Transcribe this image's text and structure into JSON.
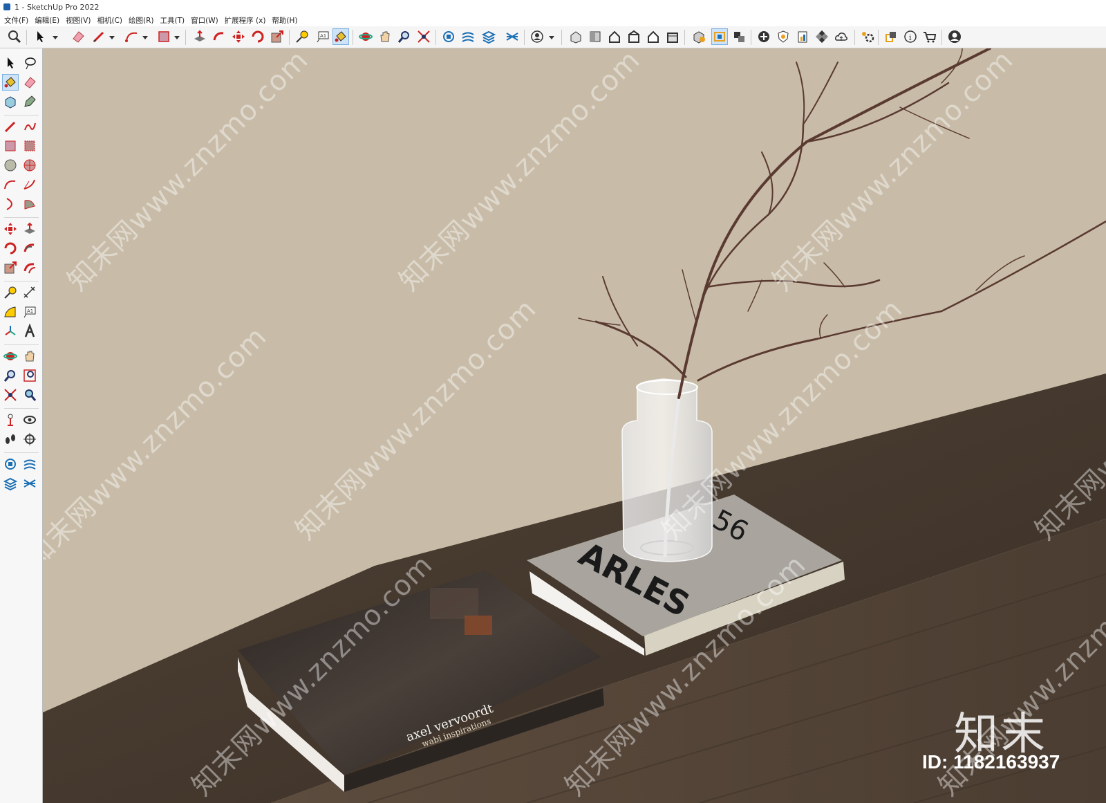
{
  "window": {
    "title": "1 - SketchUp Pro 2022"
  },
  "menu": [
    "文件(F)",
    "编辑(E)",
    "视图(V)",
    "相机(C)",
    "绘图(R)",
    "工具(T)",
    "窗口(W)",
    "扩展程序 (x)",
    "帮助(H)"
  ],
  "colors": {
    "wall": "#c8bca8",
    "counter": "#4a3c30",
    "accent": "#cfe3f7"
  },
  "toolbar_icons": [
    "search-icon",
    "select-icon",
    "eraser-icon",
    "pencil-icon",
    "arc-icon",
    "rectangle-icon",
    "pushpull-icon",
    "followme-icon",
    "move-icon",
    "rotate-icon",
    "scale-icon",
    "tapemeasure-icon",
    "text-icon",
    "paintbucket-icon",
    "orbit-icon",
    "pan-icon",
    "zoom-icon",
    "zoom-extents-icon",
    "warehouse-icon",
    "extension-warehouse-icon",
    "layers-icon",
    "sandbox-icon",
    "user-icon",
    "iso-view-icon",
    "top-view-icon",
    "front-view-icon",
    "right-view-icon",
    "back-view-icon",
    "left-view-icon",
    "xray-icon",
    "style-icon",
    "section-icon",
    "add-icon",
    "shield-icon",
    "report-icon",
    "checker-icon",
    "cloud-icon",
    "settings-icon",
    "components-icon",
    "info-icon",
    "cart-icon",
    "account-icon"
  ],
  "scene": {
    "book_dark": {
      "title": "axel vervoordt",
      "subtitle": "wabi inspirations"
    },
    "book_light": {
      "title": "ARLES",
      "number": "56"
    }
  },
  "watermark": {
    "text": "知末网www.znzmo.com",
    "logo": "知末",
    "id": "ID: 1182163937"
  }
}
